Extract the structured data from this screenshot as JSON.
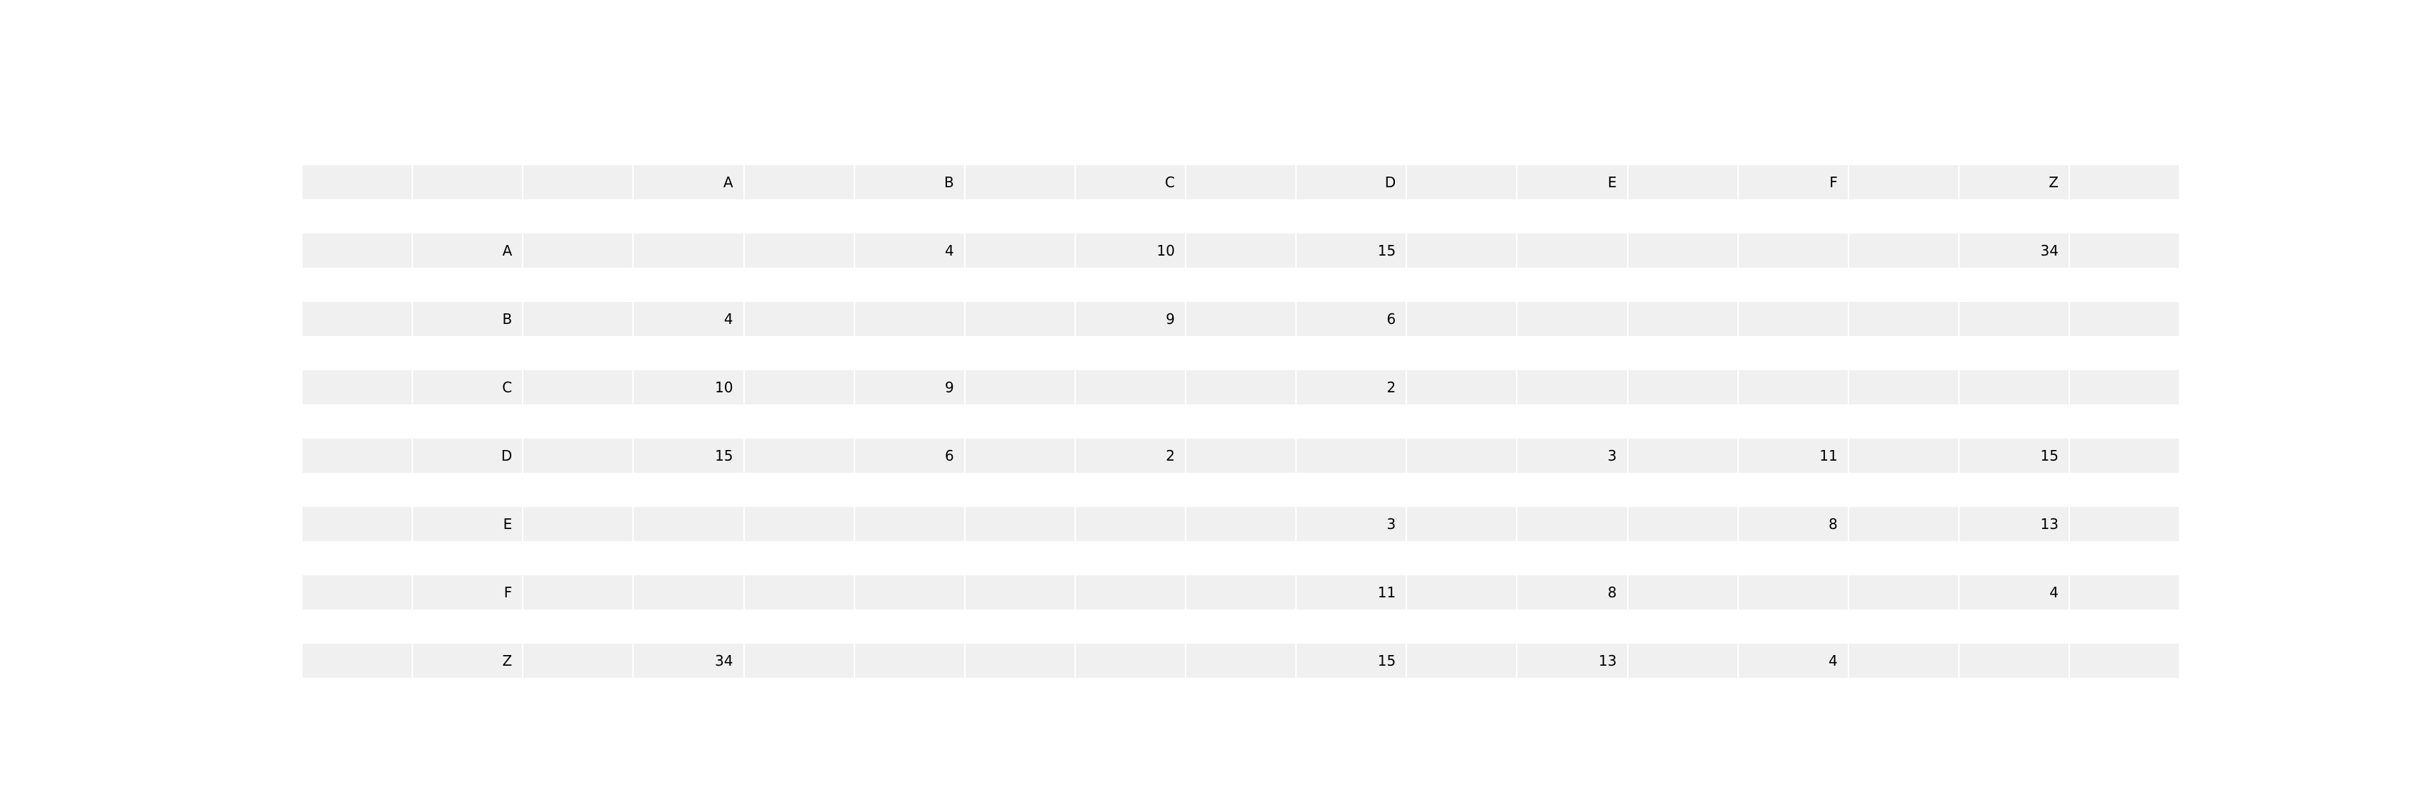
{
  "chart_data": {
    "type": "table",
    "column_headers": [
      "",
      "",
      "",
      "A",
      "",
      "B",
      "",
      "C",
      "",
      "D",
      "",
      "E",
      "",
      "F",
      "",
      "Z",
      ""
    ],
    "rows": [
      [
        "",
        "A",
        "",
        "",
        "",
        "4",
        "",
        "10",
        "",
        "15",
        "",
        "",
        "",
        "",
        "",
        "34",
        ""
      ],
      [
        "",
        "B",
        "",
        "4",
        "",
        "",
        "",
        "9",
        "",
        "6",
        "",
        "",
        "",
        "",
        "",
        "",
        ""
      ],
      [
        "",
        "C",
        "",
        "10",
        "",
        "9",
        "",
        "",
        "",
        "2",
        "",
        "",
        "",
        "",
        "",
        "",
        ""
      ],
      [
        "",
        "D",
        "",
        "15",
        "",
        "6",
        "",
        "2",
        "",
        "",
        "",
        "3",
        "",
        "11",
        "",
        "15",
        ""
      ],
      [
        "",
        "E",
        "",
        "",
        "",
        "",
        "",
        "",
        "",
        "3",
        "",
        "",
        "",
        "8",
        "",
        "13",
        ""
      ],
      [
        "",
        "F",
        "",
        "",
        "",
        "",
        "",
        "",
        "",
        "11",
        "",
        "8",
        "",
        "",
        "",
        "4",
        ""
      ],
      [
        "",
        "Z",
        "",
        "34",
        "",
        "",
        "",
        "",
        "",
        "15",
        "",
        "13",
        "",
        "4",
        "",
        "",
        ""
      ]
    ],
    "colors": {
      "cell_background": "#f0f0f0",
      "text": "#000000"
    }
  }
}
